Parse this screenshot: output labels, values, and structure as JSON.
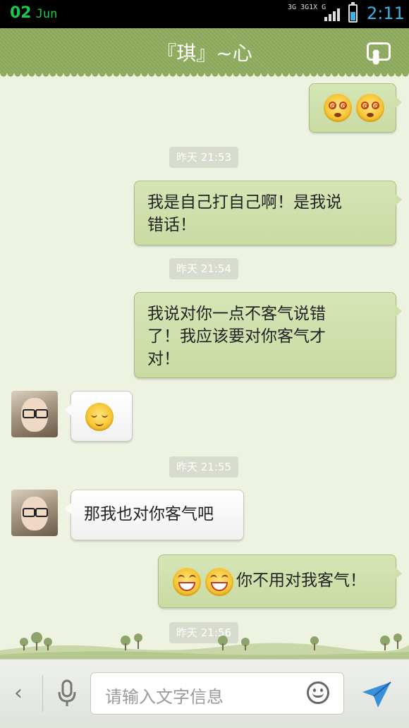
{
  "status_bar": {
    "date_day": "02",
    "date_month": "Jun",
    "network_1": "3G 3G1X G",
    "time": "2:11",
    "battery_level": 0.55
  },
  "header": {
    "title": "『琪』~心",
    "menu_icon": "more-icon"
  },
  "messages": [
    {
      "side": "out",
      "type": "emoji",
      "emoji": "dizzy-face-icon",
      "count": 2
    },
    {
      "side": "time",
      "text": "昨天 21:53"
    },
    {
      "side": "out",
      "type": "text",
      "text": "我是自己打自己啊！是我说错话！",
      "line1": "我是自己打自己啊！是我说",
      "line2": "错话！"
    },
    {
      "side": "time",
      "text": "昨天 21:54"
    },
    {
      "side": "out",
      "type": "text",
      "line1": "我说对你一点不客气说错",
      "line2": "了！我应该要对你客气才",
      "line3": "对！"
    },
    {
      "side": "in",
      "type": "emoji",
      "emoji": "relieved-face-icon"
    },
    {
      "side": "time",
      "text": "昨天 21:55"
    },
    {
      "side": "in",
      "type": "text",
      "text": "那我也对你客气吧"
    },
    {
      "side": "out",
      "type": "emoji_text",
      "emoji": "grinning-squint-face-icon",
      "count": 2,
      "text": "你不用对我客气！"
    },
    {
      "side": "time",
      "text": "昨天 21:56"
    }
  ],
  "input_bar": {
    "back_icon": "chevron-left-icon",
    "voice_icon": "microphone-icon",
    "placeholder": "请输入文字信息",
    "emoji_icon": "smiley-icon",
    "send_icon": "send-icon"
  }
}
